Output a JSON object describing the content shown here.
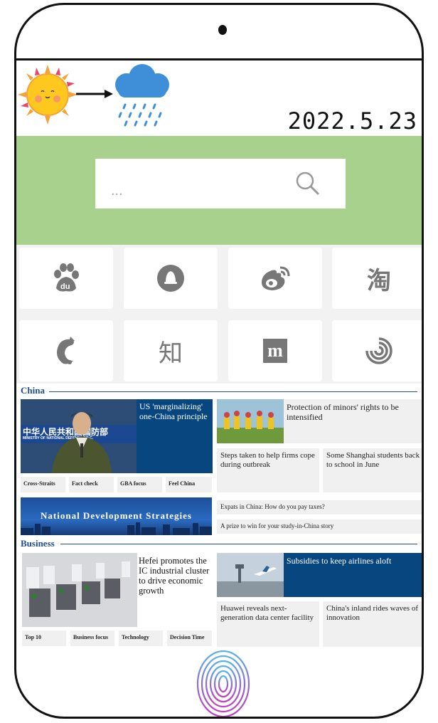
{
  "date": "2022.5.23",
  "search": {
    "placeholder": "..."
  },
  "apps": [
    {
      "name": "baidu",
      "glyph": "du"
    },
    {
      "name": "qq",
      "glyph": ""
    },
    {
      "name": "weibo",
      "glyph": ""
    },
    {
      "name": "taobao",
      "glyph": "淘"
    },
    {
      "name": "ctrip",
      "glyph": ""
    },
    {
      "name": "zhihu",
      "glyph": "知"
    },
    {
      "name": "m-app",
      "glyph": "m"
    },
    {
      "name": "ifeng",
      "glyph": ""
    }
  ],
  "china": {
    "heading": "China",
    "feature_photo_text": "中华人民共和国国防部",
    "feature_photo_subtext": "MINISTRY OF NATIONAL DEFENSE,P.R.C.",
    "feature_headline": "US 'marginalizing' one-China principle",
    "side_headline": "Protection of minors' rights to be intensified",
    "story_1": "Steps taken to help firms cope during outbreak",
    "story_2": "Some Shanghai students back to school in June",
    "tags": [
      "Cross-Straits",
      "Fact check",
      "GBA focus",
      "Feel China"
    ],
    "banner": "National Development Strategies",
    "link_1": "Expats in China: How do you pay taxes?",
    "link_2": "A prize to win for your study-in-China story"
  },
  "business": {
    "heading": "Business",
    "feature_headline": "Hefei promotes the IC industrial cluster to drive economic growth",
    "side_headline": "Subsidies to keep airlines aloft",
    "story_1": "Huawei reveals next-generation data center facility",
    "story_2": "China's inland rides waves of innovation",
    "tags": [
      "Top 10",
      "Business focus",
      "Technology",
      "Decision Time"
    ]
  }
}
